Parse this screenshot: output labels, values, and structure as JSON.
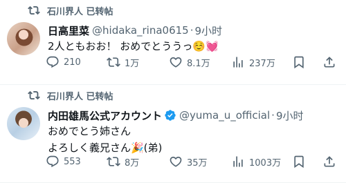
{
  "tweets": [
    {
      "retweeted_by": "石川界人 已转帖",
      "display_name": "日高里菜",
      "verified": false,
      "handle": "@hidaka_rina0615",
      "time": "9小时",
      "body_lines": [
        "2人ともおお！ おめでとううっ☺️💓"
      ],
      "stats": {
        "replies": "210",
        "retweets": "1万",
        "likes": "8.1万",
        "views": "237万"
      }
    },
    {
      "retweeted_by": "石川界人 已转帖",
      "display_name": "内田雄馬公式アカウント",
      "verified": true,
      "handle": "@yuma_u_official",
      "time": "9小时",
      "body_lines": [
        "おめでとう姉さん",
        "よろしく義兄さん🎉(弟)"
      ],
      "stats": {
        "replies": "553",
        "retweets": "8万",
        "likes": "35万",
        "views": "1003万"
      }
    }
  ],
  "icons": {
    "retweet": "retweet-icon",
    "reply": "reply-icon",
    "like": "heart-icon",
    "views": "views-icon",
    "bookmark": "bookmark-icon",
    "share": "share-icon",
    "verified": "verified-badge-icon"
  },
  "colors": {
    "text_primary": "#0f1419",
    "text_secondary": "#536471",
    "verified_blue": "#1d9bf0",
    "divider": "#eff3f4"
  }
}
